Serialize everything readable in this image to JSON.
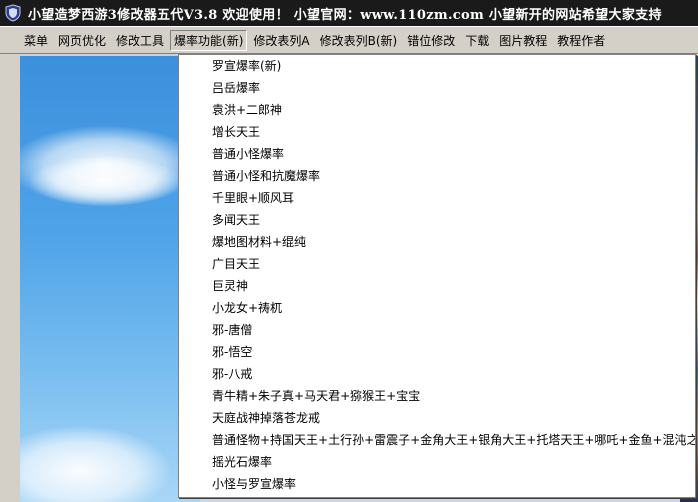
{
  "window": {
    "title": "小望造梦西游3修改器五代V3.8    欢迎使用！  小望官网：www.110zm.com    小望新开的网站希望大家支持"
  },
  "menu": {
    "items": [
      {
        "label": "菜单"
      },
      {
        "label": "网页优化"
      },
      {
        "label": "修改工具"
      },
      {
        "label": "爆率功能(新)",
        "active": true
      },
      {
        "label": "修改表列A"
      },
      {
        "label": "修改表列B(新)"
      },
      {
        "label": "错位修改"
      },
      {
        "label": "下载"
      },
      {
        "label": "图片教程"
      },
      {
        "label": "教程作者"
      }
    ]
  },
  "dropdown": {
    "items": [
      "罗宣爆率(新)",
      "吕岳爆率",
      "袁洪+二郎神",
      "增长天王",
      "普通小怪爆率",
      "普通小怪和抗魔爆率",
      "千里眼+顺风耳",
      "多闻天王",
      "爆地图材料+绲纯",
      "广目天王",
      "巨灵神",
      "小龙女+祷杌",
      "邪-唐僧",
      "邪-悟空",
      "邪-八戒",
      "青牛精+朱子真+马天君+猕猴王+宝宝",
      "天庭战神掉落苍龙戒",
      "普通怪物+持国天王+土行孙+雷震子+金角大王+银角大王+托塔天王+哪吒+金鱼+混沌之光+",
      "摇光石爆率",
      "小怪与罗宣爆率"
    ]
  },
  "colors": {
    "titlebar": "#1a1a1a",
    "menubar": "#d4d0c8",
    "sky": "#4fa3e8",
    "dropdown_bg": "#ffffff"
  },
  "icons": {
    "app": "shield-icon"
  }
}
